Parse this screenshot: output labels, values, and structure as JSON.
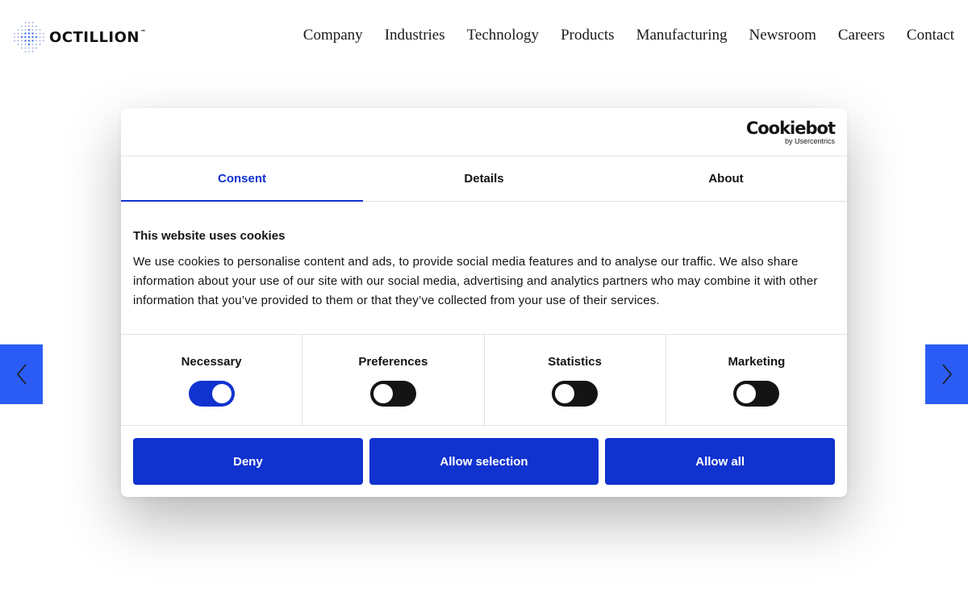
{
  "header": {
    "logo_text": "OCTILLION",
    "logo_tm": "™",
    "nav": [
      "Company",
      "Industries",
      "Technology",
      "Products",
      "Manufacturing",
      "Newsroom",
      "Careers",
      "Contact"
    ]
  },
  "dialog": {
    "brand": {
      "name": "Cookiebot",
      "sub": "by Usercentrics"
    },
    "tabs": [
      {
        "label": "Consent",
        "active": true
      },
      {
        "label": "Details",
        "active": false
      },
      {
        "label": "About",
        "active": false
      }
    ],
    "title": "This website uses cookies",
    "description": "We use cookies to personalise content and ads, to provide social media features and to analyse our traffic. We also share information about your use of our site with our social media, advertising and analytics partners who may combine it with other information that you’ve provided to them or that they’ve collected from your use of their services.",
    "toggles": [
      {
        "label": "Necessary",
        "on": true
      },
      {
        "label": "Preferences",
        "on": false
      },
      {
        "label": "Statistics",
        "on": false
      },
      {
        "label": "Marketing",
        "on": false
      }
    ],
    "buttons": {
      "deny": "Deny",
      "allow_selection": "Allow selection",
      "allow_all": "Allow all"
    }
  },
  "colors": {
    "accent": "#1032cf",
    "arrow": "#2b5cf6",
    "text": "#141414"
  },
  "icons": {
    "slider_prev": "chevron-left-icon",
    "slider_next": "chevron-right-icon",
    "logo": "dot-grid-logo-icon"
  }
}
